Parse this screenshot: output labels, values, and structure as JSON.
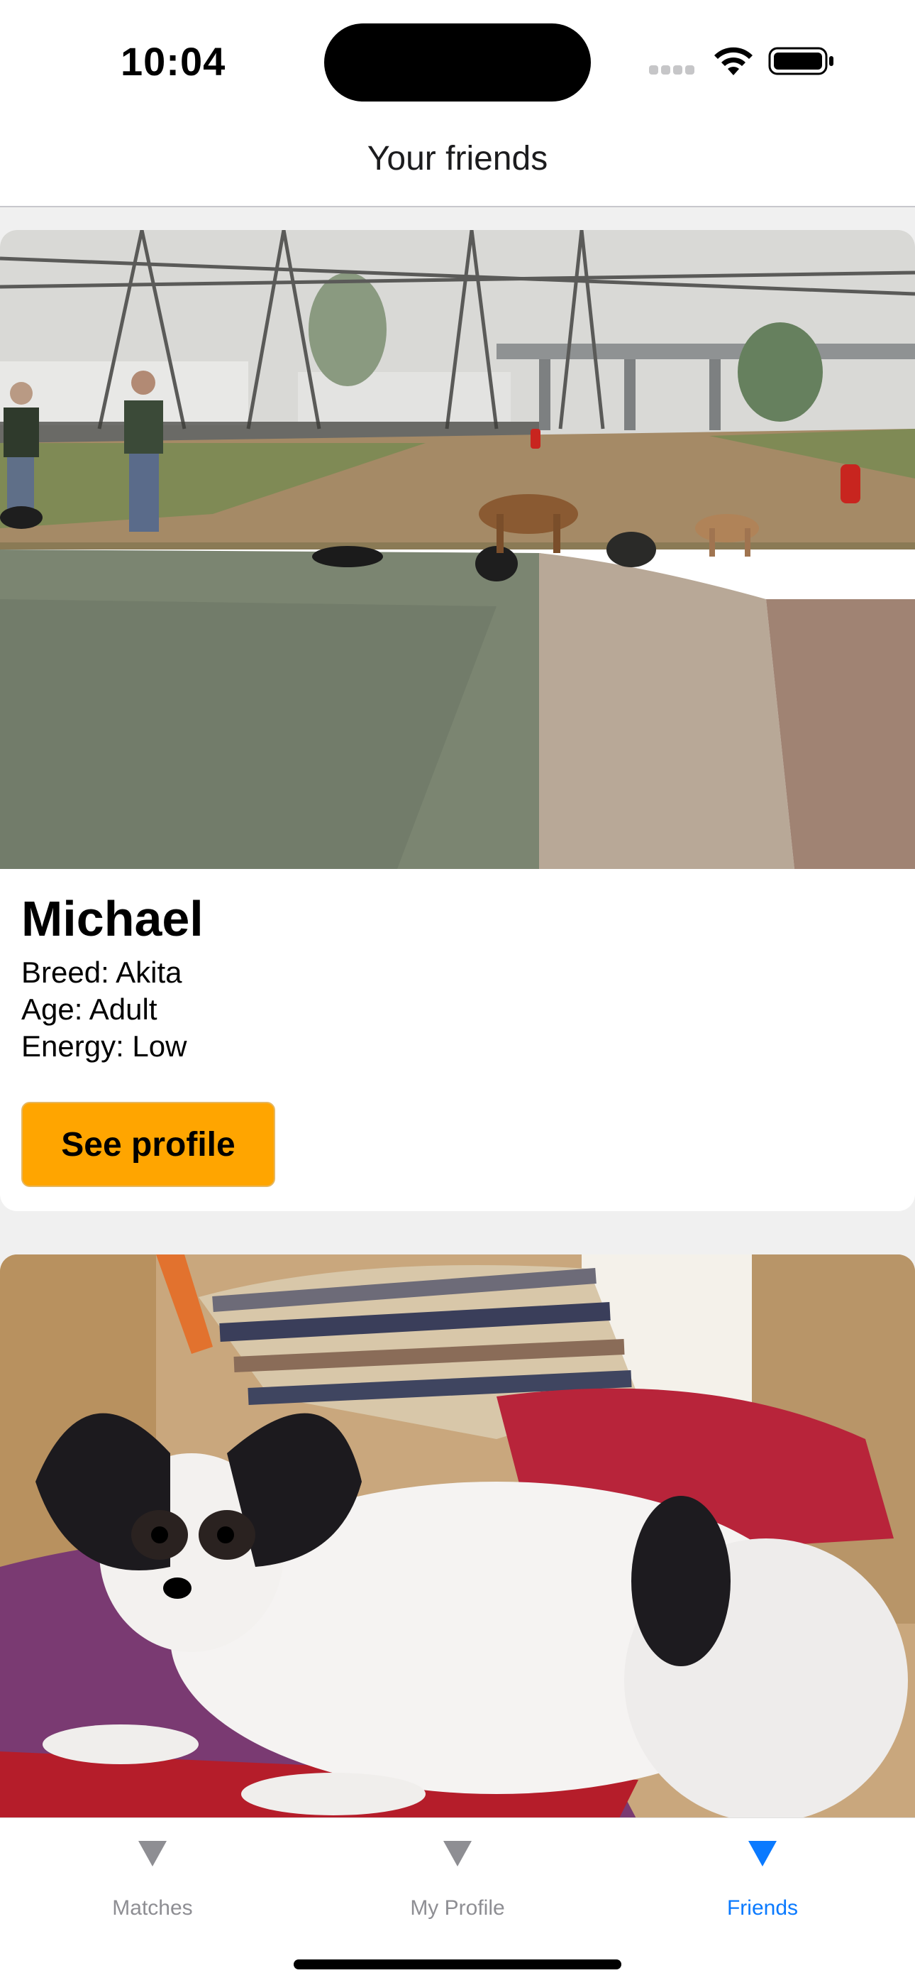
{
  "status_bar": {
    "time": "10:04"
  },
  "header": {
    "title": "Your friends"
  },
  "friends": [
    {
      "name": "Michael",
      "breed": "Breed: Akita",
      "age": "Age: Adult",
      "energy": "Energy: Low",
      "button_label": "See profile",
      "photo_icon": "dog-park-photo"
    },
    {
      "photo_icon": "papillon-dog-photo"
    }
  ],
  "tab_bar": {
    "tabs": [
      {
        "label": "Matches",
        "icon": "triangle-down-icon",
        "active": false
      },
      {
        "label": "My Profile",
        "icon": "triangle-down-icon",
        "active": false
      },
      {
        "label": "Friends",
        "icon": "triangle-down-icon",
        "active": true
      }
    ]
  },
  "colors": {
    "accent": "#0a7aff",
    "button": "#ffa500",
    "inactive_tab": "#8e8e93",
    "background": "#f0f0f0"
  }
}
